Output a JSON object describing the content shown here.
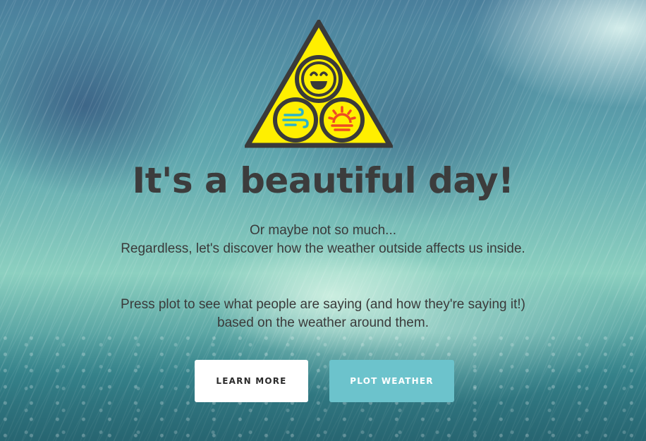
{
  "hero": {
    "title": "It's a beautiful day!",
    "intro_lines": [
      "Or maybe not so much...",
      "Regardless, let's discover how the weather outside affects us inside."
    ],
    "prompt_lines": [
      "Press plot to see what people are saying (and how they're saying it!)",
      "based on the weather around them."
    ]
  },
  "buttons": {
    "learn_more": "LEARN MORE",
    "plot_weather": "PLOT WEATHER"
  },
  "logo": {
    "icons": [
      "smiley-face-icon",
      "wind-icon",
      "sunrise-icon"
    ]
  },
  "colors": {
    "title_text": "#3c3c3c",
    "logo_yellow": "#ffef00",
    "logo_outline": "#3a3a3a",
    "wind_icon": "#2bb3c8",
    "sunrise_icon": "#ef4a22",
    "learn_button_bg": "#ffffff",
    "plot_button_bg": "#6cc3cc"
  }
}
